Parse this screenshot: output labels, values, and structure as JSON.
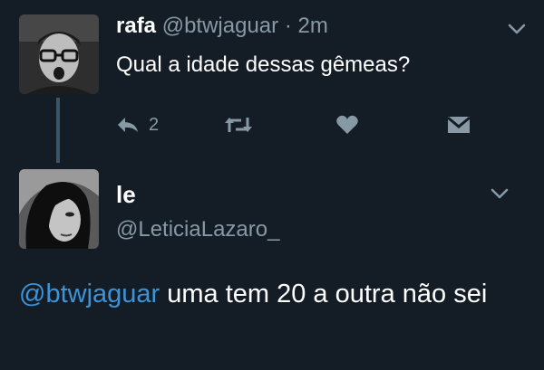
{
  "tweet": {
    "author_name": "rafa",
    "author_handle": "@btwjaguar",
    "separator": "·",
    "time": "2m",
    "text": "Qual a idade dessas gêmeas?",
    "reply_count": "2"
  },
  "reply": {
    "author_name": "le",
    "author_handle": "@LeticiaLazaro_",
    "mention": "@btwjaguar",
    "text": " uma tem 20 a outra não sei"
  },
  "icons": {
    "reply": "reply-arrow-icon",
    "retweet": "retweet-icon",
    "like": "heart-icon",
    "dm": "envelope-icon",
    "menu": "chevron-down-icon"
  },
  "colors": {
    "background": "#141d26",
    "primary_text": "#ffffff",
    "secondary_text": "#8899a6",
    "link": "#3b94d9",
    "thread_line": "#3d5466"
  }
}
